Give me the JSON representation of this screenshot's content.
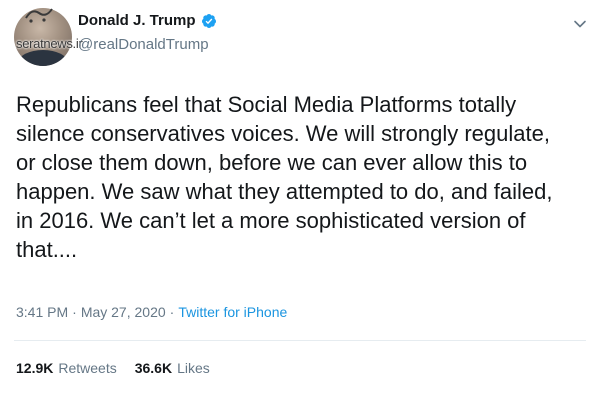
{
  "author": {
    "display_name": "Donald J. Trump",
    "handle": "@realDonaldTrump",
    "verified": true
  },
  "watermark": {
    "text": "seratnews.ir"
  },
  "tweet": {
    "lines": [
      "Republicans feel that Social Media Platforms totally",
      "silence conservatives voices. We will strongly regulate,",
      "or close them down, before we can ever allow this to",
      "happen. We saw what they attempted to do, and failed,",
      "in 2016. We can’t let a more sophisticated version of",
      "that...."
    ]
  },
  "meta": {
    "time": "3:41 PM",
    "sep1": "·",
    "date": "May 27, 2020",
    "sep2": "·",
    "source": "Twitter for iPhone"
  },
  "stats": {
    "retweets_count": "12.9K",
    "retweets_label": "Retweets",
    "likes_count": "36.6K",
    "likes_label": "Likes"
  },
  "colors": {
    "text": "#14171a",
    "muted": "#657786",
    "link": "#1b95e0",
    "verified": "#1da1f2"
  },
  "icons": {
    "verified": "verified-badge-icon",
    "menu": "chevron-down-icon"
  }
}
